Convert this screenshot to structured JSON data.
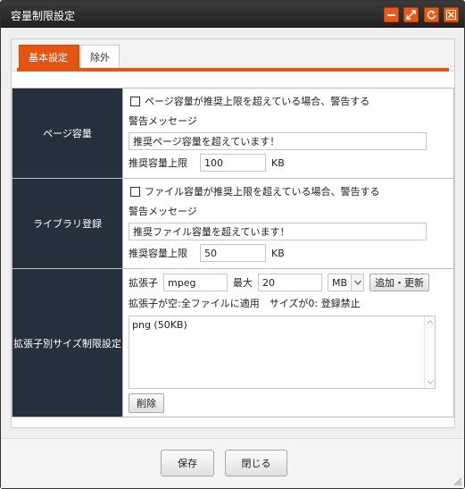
{
  "window": {
    "title": "容量制限設定",
    "accent": "#e6540f"
  },
  "tabs": [
    {
      "label": "基本設定",
      "active": true
    },
    {
      "label": "除外",
      "active": false
    }
  ],
  "page": {
    "label": "ページ容量",
    "checkbox_label": "ページ容量が推奨上限を超えている場合、警告する",
    "checked": false,
    "message_label": "警告メッセージ",
    "message_value": "推奨ページ容量を超えています！",
    "limit_label": "推奨容量上限",
    "limit_value": "100",
    "unit": "KB"
  },
  "library": {
    "label": "ライブラリ登録",
    "checkbox_label": "ファイル容量が推奨上限を超えている場合、警告する",
    "checked": false,
    "message_label": "警告メッセージ",
    "message_value": "推奨ファイル容量を超えています！",
    "limit_label": "推奨容量上限",
    "limit_value": "50",
    "unit": "KB"
  },
  "ext": {
    "label": "拡張子別サイズ制限設定",
    "ext_label": "拡張子",
    "ext_value": "mpeg",
    "max_label": "最大",
    "max_value": "20",
    "unit_selected": "MB",
    "add_button": "追加・更新",
    "hint": "拡張子が空:全ファイルに適用　サイズが0: 登録禁止",
    "list_items": [
      "png (50KB)"
    ],
    "delete_button": "削除"
  },
  "footer": {
    "save_button": "保存",
    "close_button": "閉じる"
  }
}
